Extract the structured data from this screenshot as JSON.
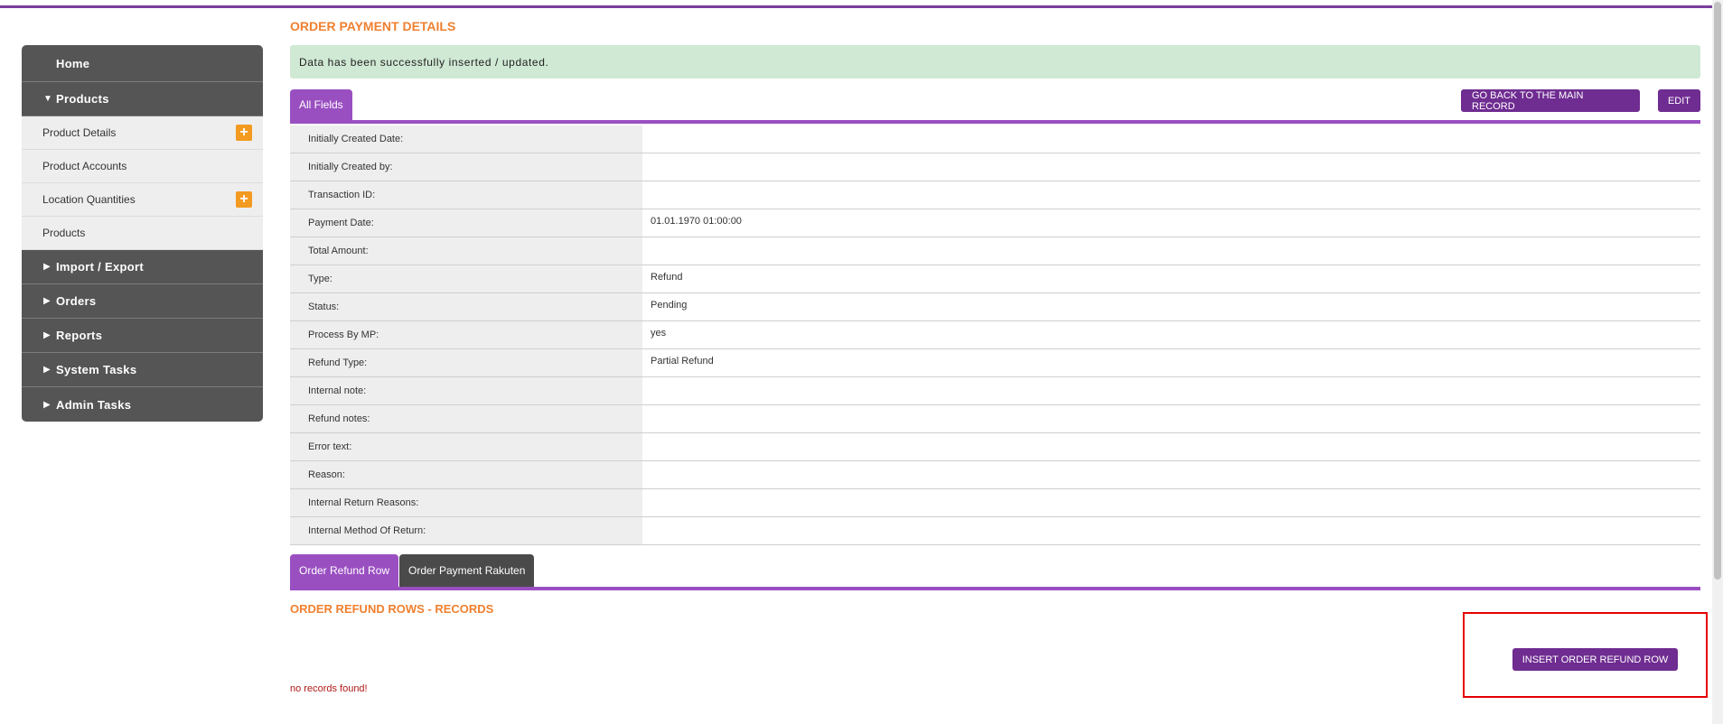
{
  "page_title": "ORDER PAYMENT DETAILS",
  "alert_text": "Data has been successfully inserted / updated.",
  "sidebar": {
    "home": "Home",
    "products_header": "Products",
    "product_items": [
      {
        "label": "Product Details",
        "has_add": true
      },
      {
        "label": "Product Accounts",
        "has_add": false
      },
      {
        "label": "Location Quantities",
        "has_add": true
      },
      {
        "label": "Products",
        "has_add": false
      }
    ],
    "sections": [
      "Import / Export",
      "Orders",
      "Reports",
      "System Tasks",
      "Admin Tasks"
    ],
    "add_symbol": "+",
    "expanded_symbol": "▼",
    "collapsed_symbol": "▶"
  },
  "tabs": {
    "all_fields": "All Fields",
    "order_refund_row": "Order Refund Row",
    "order_payment_rakuten": "Order Payment Rakuten"
  },
  "buttons": {
    "go_back": "GO BACK TO THE MAIN RECORD",
    "edit": "EDIT",
    "insert_refund_row": "INSERT ORDER REFUND ROW"
  },
  "fields": [
    {
      "label": "Initially Created Date:",
      "value": ""
    },
    {
      "label": "Initially Created by:",
      "value": ""
    },
    {
      "label": "Transaction ID:",
      "value": ""
    },
    {
      "label": "Payment Date:",
      "value": "01.01.1970 01:00:00"
    },
    {
      "label": "Total Amount:",
      "value": ""
    },
    {
      "label": "Type:",
      "value": "Refund"
    },
    {
      "label": "Status:",
      "value": "Pending"
    },
    {
      "label": "Process By MP:",
      "value": "yes"
    },
    {
      "label": "Refund Type:",
      "value": "Partial Refund"
    },
    {
      "label": "Internal note:",
      "value": ""
    },
    {
      "label": "Refund notes:",
      "value": ""
    },
    {
      "label": "Error text:",
      "value": ""
    },
    {
      "label": "Reason:",
      "value": ""
    },
    {
      "label": "Internal Return Reasons:",
      "value": ""
    },
    {
      "label": "Internal Method Of Return:",
      "value": ""
    }
  ],
  "records_title": "ORDER REFUND ROWS - RECORDS",
  "no_records": "no records found!",
  "colors": {
    "accent_purple": "#9a4fc1",
    "button_purple": "#6f2c91",
    "title_orange": "#f0802f",
    "add_orange": "#f39a21",
    "alert_green": "#d0e9d4",
    "highlight_red": "#e60000"
  }
}
